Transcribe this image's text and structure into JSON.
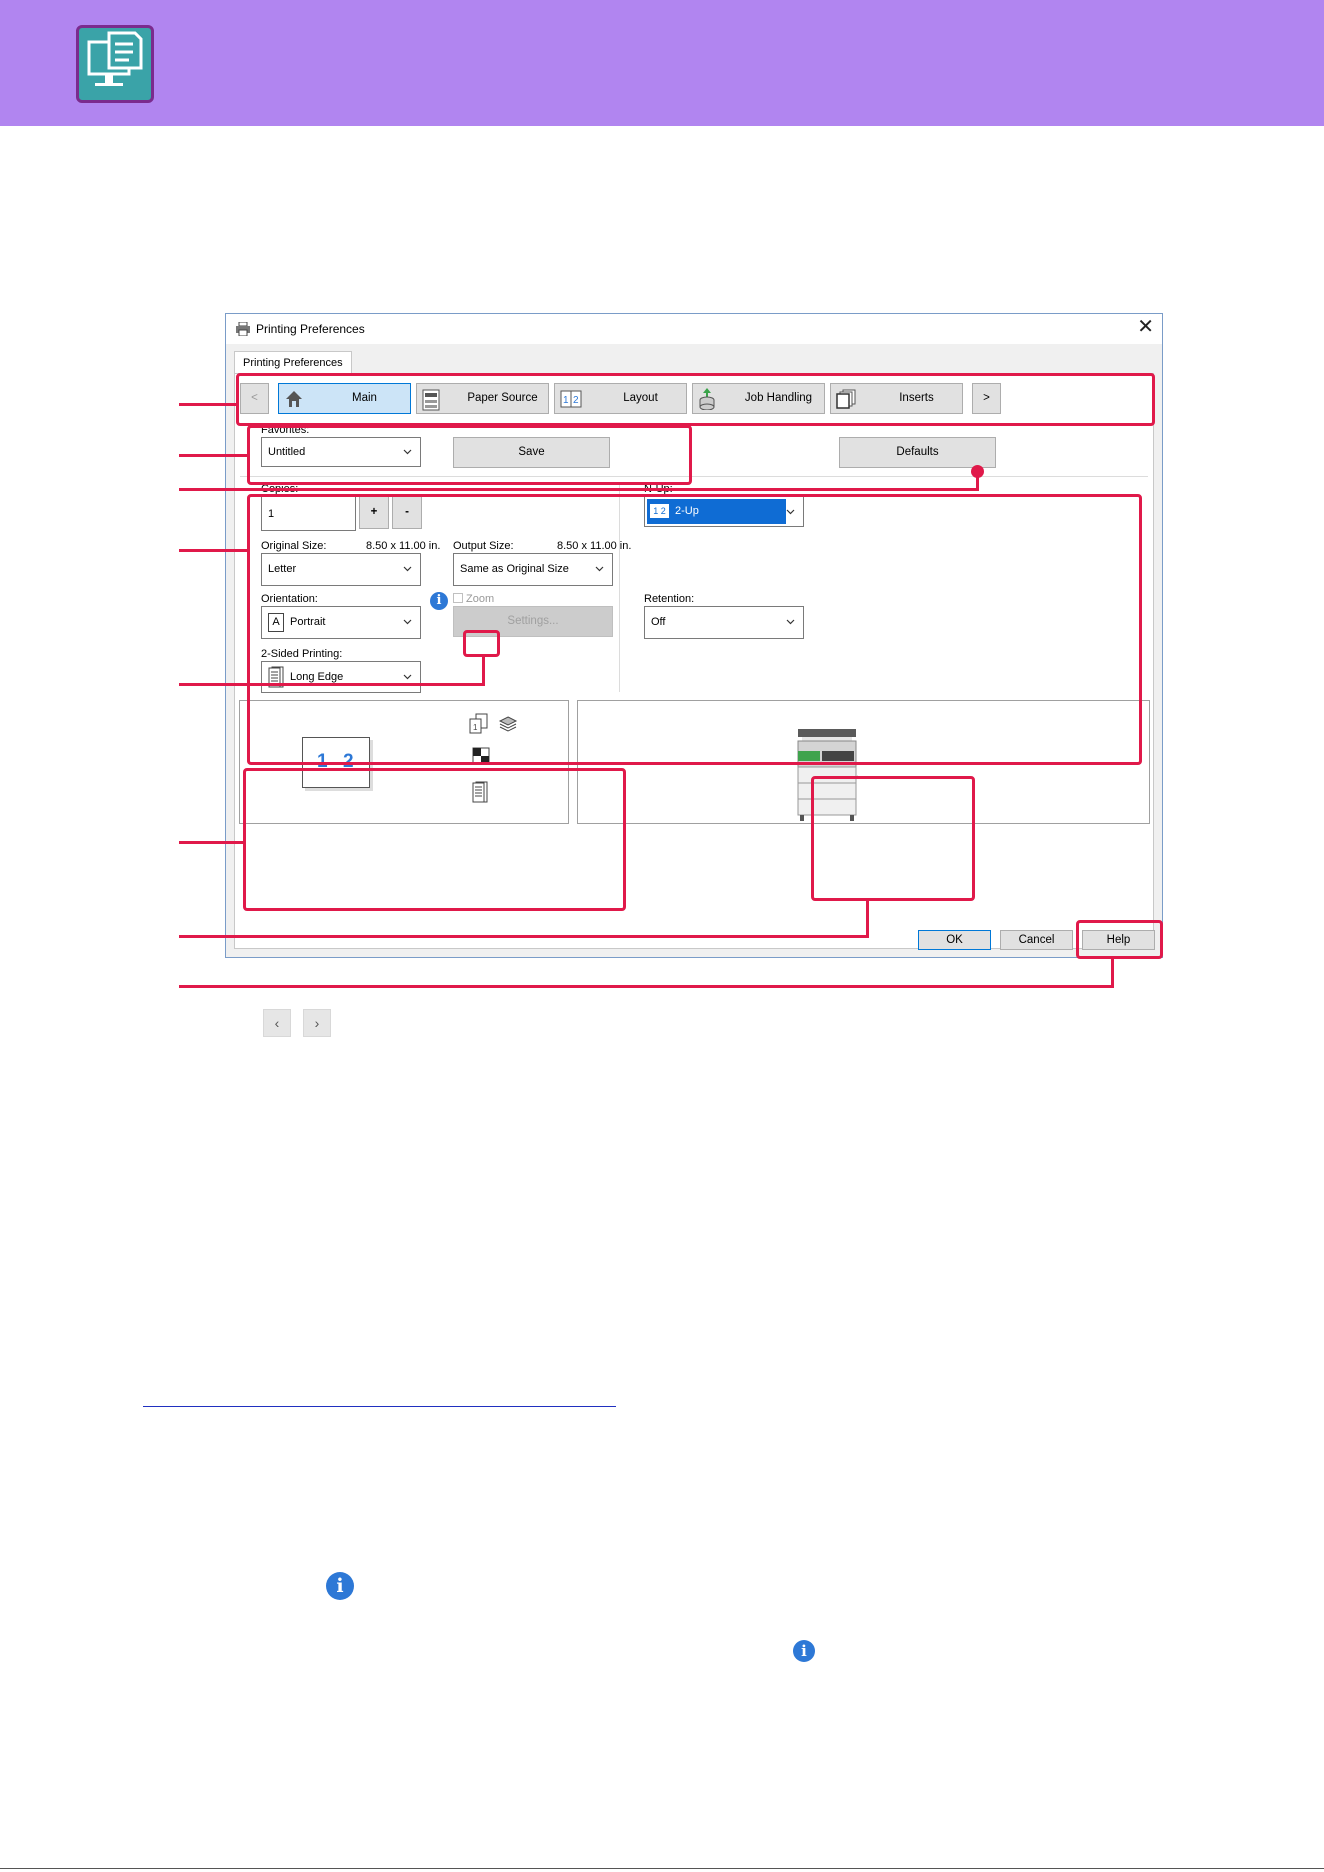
{
  "window": {
    "title": "Printing Preferences",
    "outer_tab": "Printing Preferences",
    "close_glyph": "✕"
  },
  "tabs": {
    "prev": "<",
    "next": ">",
    "items": [
      {
        "label": "Main",
        "icon": "home-icon",
        "active": true
      },
      {
        "label": "Paper Source",
        "icon": "printer-tray-icon"
      },
      {
        "label": "Layout",
        "icon": "layout-1-2-icon"
      },
      {
        "label": "Job Handling",
        "icon": "storage-icon"
      },
      {
        "label": "Inserts",
        "icon": "insert-pages-icon"
      }
    ]
  },
  "favorites": {
    "label": "Favorites:",
    "value": "Untitled",
    "save": "Save",
    "defaults": "Defaults"
  },
  "copies": {
    "label": "Copies:",
    "value": "1",
    "plus": "+",
    "minus": "-"
  },
  "original_size": {
    "label": "Original Size:",
    "dims": "8.50 x 11.00 in.",
    "value": "Letter"
  },
  "output_size": {
    "label": "Output Size:",
    "dims": "8.50 x 11.00 in.",
    "value": "Same as Original Size"
  },
  "orientation": {
    "label": "Orientation:",
    "value": "Portrait",
    "icon_letter": "A"
  },
  "zoom": {
    "label": "Zoom",
    "checked": false,
    "settings": "Settings..."
  },
  "two_sided": {
    "label": "2-Sided Printing:",
    "value": "Long Edge"
  },
  "nup": {
    "label": "N-Up:",
    "value": "2-Up",
    "icon": "1 2"
  },
  "retention": {
    "label": "Retention:",
    "value": "Off"
  },
  "preview": {
    "page_1": "1",
    "page_2": "2"
  },
  "footer": {
    "ok": "OK",
    "cancel": "Cancel",
    "help": "Help"
  },
  "page_nav": {
    "prev": "‹",
    "next": "›"
  },
  "colors": {
    "header": "#b185f0",
    "callout": "#e0194a",
    "selection": "#0f6cd4",
    "info": "#2d78d6"
  }
}
